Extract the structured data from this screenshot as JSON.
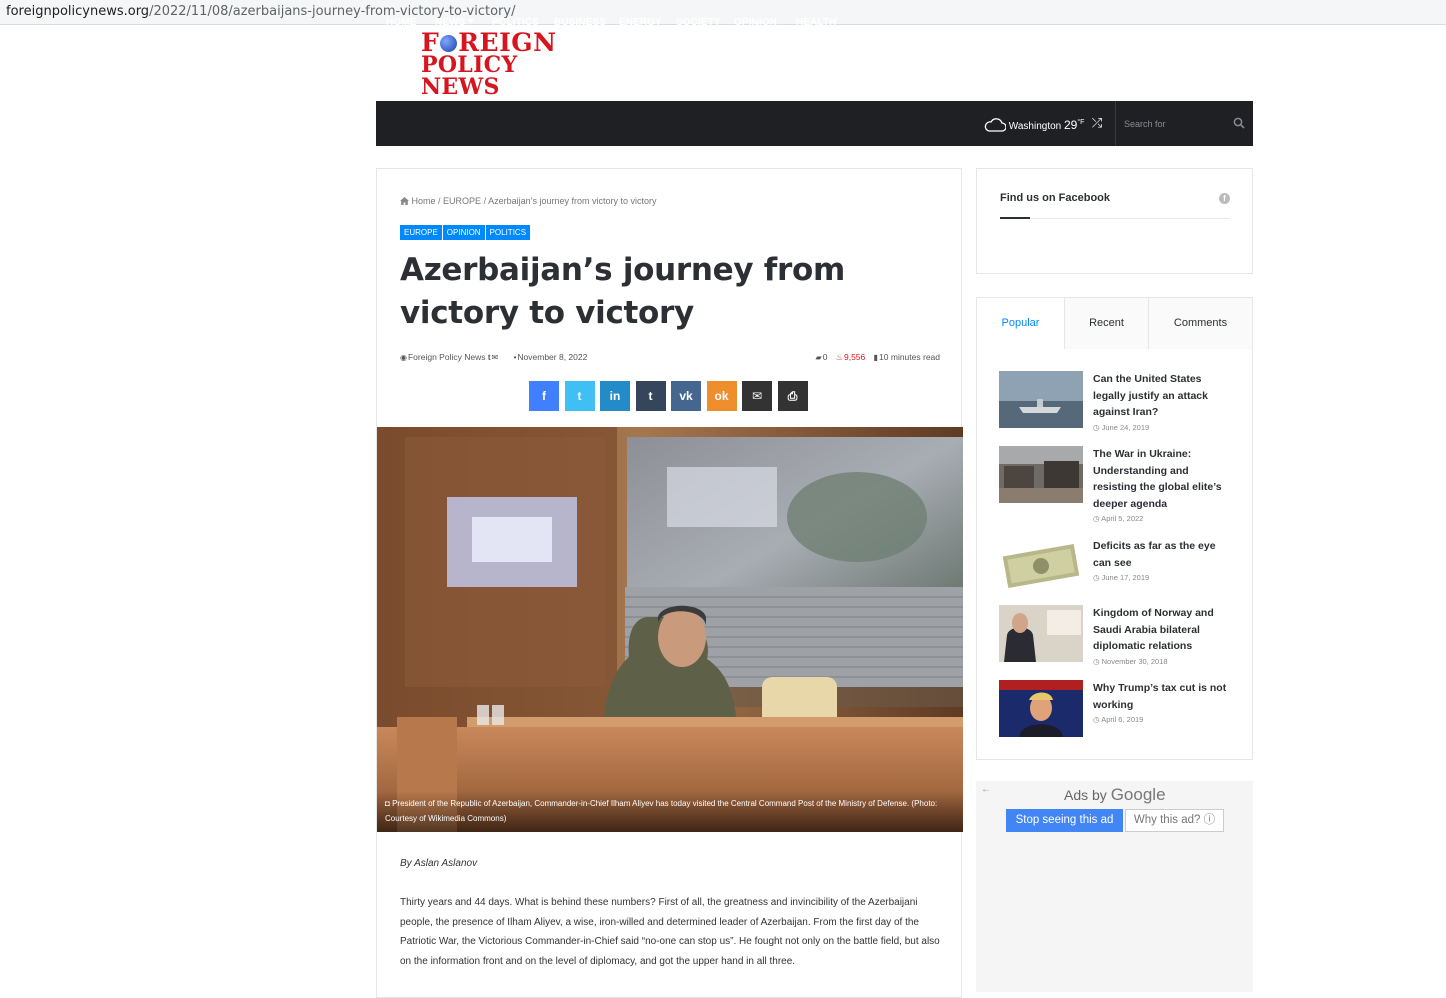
{
  "browser": {
    "url_domain": "foreignpolicynews.org",
    "url_path": "/2022/11/08/azerbaijans-journey-from-victory-to-victory/"
  },
  "site": {
    "logo_line1_a": "F",
    "logo_line1_b": "REIGN",
    "logo_line2": "POLICY NEWS",
    "brand_color": "#d6151f",
    "accent_color": "#0088ff"
  },
  "nav": {
    "items": [
      "HOME",
      "NEWS",
      "POLITICS",
      "BUSINESS",
      "ENERGY",
      "SOCIETY",
      "OPINION",
      "HEALTH"
    ],
    "weather_city": "Washington",
    "weather_temp": "29",
    "weather_unit": "°F",
    "search_placeholder": "Search for"
  },
  "article": {
    "breadcrumb": {
      "home": "Home",
      "sep1": " / ",
      "section": "EUROPE",
      "sep2": " / ",
      "current": "Azerbaijan’s journey from victory to victory"
    },
    "tags": [
      "EUROPE",
      "OPINION",
      "POLITICS"
    ],
    "title": "Azerbaijan’s journey from victory to victory",
    "author": "Foreign Policy News",
    "date": "November 8, 2022",
    "comments": "0",
    "views": "9,556",
    "read_time": "10 minutes read",
    "share_buttons": [
      {
        "name": "facebook",
        "glyph": "f",
        "color": "#4080ff"
      },
      {
        "name": "twitter",
        "glyph": "t",
        "color": "#40bff5"
      },
      {
        "name": "linkedin",
        "glyph": "in",
        "color": "#238cc8"
      },
      {
        "name": "tumblr",
        "glyph": "t",
        "color": "#35465c"
      },
      {
        "name": "vk",
        "glyph": "vk",
        "color": "#45668e"
      },
      {
        "name": "odnoklassniki",
        "glyph": "ok",
        "color": "#ef8e2d"
      },
      {
        "name": "email",
        "glyph": "✉",
        "color": "#333333"
      },
      {
        "name": "print",
        "glyph": "⎙",
        "color": "#333333"
      }
    ],
    "caption": "President of the Republic of Azerbaijan, Commander-in-Chief Ilham Aliyev has today visited the Central Command Post of the Ministry of Defense. (Photo: Courtesy of Wikimedia Commons)",
    "byline": "By Aslan Aslanov",
    "paragraph1": "Thirty years and 44 days. What is behind these numbers? First of all, the greatness and invincibility of the Azerbaijani people, the presence of Ilham Aliyev, a wise, iron-willed and determined leader of Azerbaijan. From the first day of the Patriotic War, the Victorious Commander-in-Chief said “no-one can stop us”. He fought not only on the battle field, but also on the information front and on the level of diplomacy, and got the upper hand in all three."
  },
  "sidebar": {
    "facebook_title": "Find us on Facebook",
    "tabs": [
      "Popular",
      "Recent",
      "Comments"
    ],
    "posts": [
      {
        "title": "Can the United States legally justify an attack against Iran?",
        "date": "June 24, 2019"
      },
      {
        "title": "The War in Ukraine: Understanding and resisting the global elite’s deeper agenda",
        "date": "April 5, 2022"
      },
      {
        "title": "Deficits as far as the eye can see",
        "date": "June 17, 2019"
      },
      {
        "title": "Kingdom of Norway and Saudi Arabia bilateral diplomatic relations",
        "date": "November 30, 2018"
      },
      {
        "title": "Why Trump’s tax cut is not working",
        "date": "April 6, 2019"
      }
    ]
  },
  "ad": {
    "ads_by": "Ads by",
    "google": "Google",
    "stop_label": "Stop seeing this ad",
    "why_label": "Why this ad? ⓘ",
    "back_arrow": "←"
  }
}
